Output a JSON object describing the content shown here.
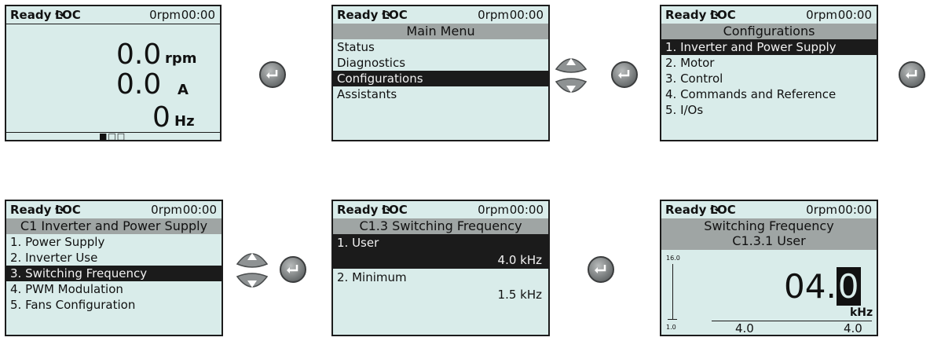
{
  "status_bar": {
    "ready": "Ready",
    "loc": "LOC",
    "speed": "0rpm",
    "time": "00:00",
    "rotation_icon": "rotation-arrow-icon"
  },
  "screen1": {
    "rpm_value": "0.0",
    "rpm_unit": "rpm",
    "current_value": "0.0",
    "current_unit": "A",
    "freq_value": "0",
    "freq_unit": "Hz",
    "page_indicator": "■□□"
  },
  "screen2": {
    "title": "Main Menu",
    "items": [
      "Status",
      "Diagnostics",
      "Configurations",
      "Assistants"
    ],
    "selected_index": 2
  },
  "screen3": {
    "title": "Configurations",
    "items": [
      "1. Inverter and Power Supply",
      "2. Motor",
      "3. Control",
      "4. Commands and Reference",
      "5. I/Os"
    ],
    "selected_index": 0
  },
  "screen4": {
    "title": "C1 Inverter and Power Supply",
    "items": [
      "1. Power Supply",
      "2. Inverter Use",
      "3. Switching Frequency",
      "4. PWM Modulation",
      "5. Fans Configuration"
    ],
    "selected_index": 2
  },
  "screen5": {
    "title": "C1.3 Switching Frequency",
    "user_label": "1. User",
    "user_value": "4.0 kHz",
    "minimum_label": "2. Minimum",
    "minimum_value": "1.5 kHz"
  },
  "screen6": {
    "title_line1": "Switching Frequency",
    "title_line2": "C1.3.1 User",
    "scale_max": "16.0",
    "scale_min": "1.0",
    "value_prefix": "04.",
    "value_cursor": "0",
    "unit": "kHz",
    "current": "4.0",
    "set": "4.0"
  },
  "colors": {
    "lcd_bg": "#d9ecea",
    "header_bg": "#9fa5a4",
    "selected_bg": "#1b1b1b"
  }
}
